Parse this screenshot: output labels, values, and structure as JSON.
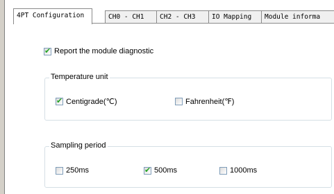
{
  "tabs": [
    {
      "label": "4PT Configuration",
      "active": true
    },
    {
      "label": "CH0 - CH1",
      "active": false
    },
    {
      "label": "CH2 - CH3",
      "active": false
    },
    {
      "label": "IO Mapping",
      "active": false
    },
    {
      "label": "Module informa",
      "active": false
    }
  ],
  "diagnostic": {
    "label": "Report the module diagnostic",
    "checked": true
  },
  "temperature_unit": {
    "title": "Temperature unit",
    "options": [
      {
        "label": "Centigrade(℃)",
        "checked": true
      },
      {
        "label": "Fahrenheit(℉)",
        "checked": false
      }
    ]
  },
  "sampling_period": {
    "title": "Sampling period",
    "options": [
      {
        "label": "250ms",
        "checked": false
      },
      {
        "label": "500ms",
        "checked": true
      },
      {
        "label": "1000ms",
        "checked": false
      }
    ]
  },
  "colors": {
    "check_mark": "#21a121",
    "group_border": "#d5dfe5",
    "tab_border": "#8a8a8a"
  },
  "icons": {
    "checked": "check-icon"
  }
}
